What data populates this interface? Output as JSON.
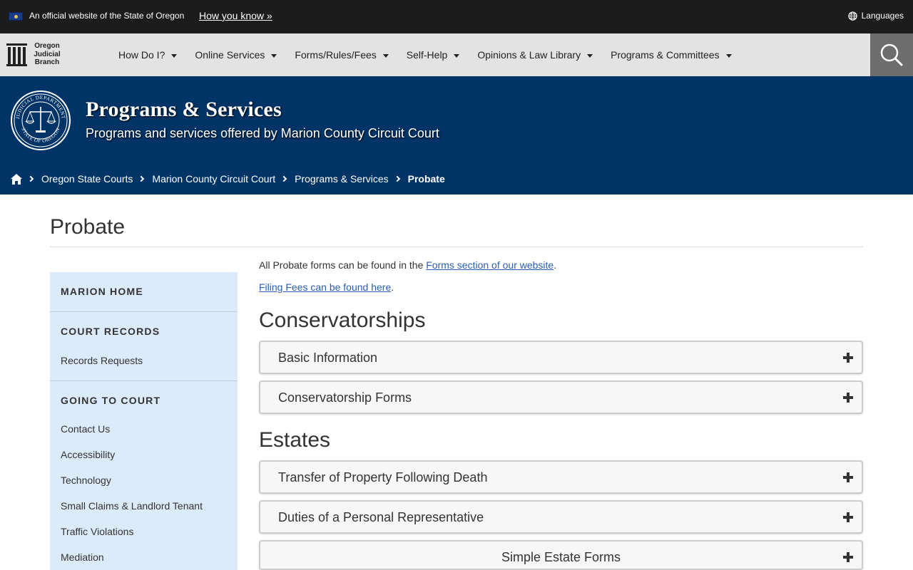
{
  "banner": {
    "official_text": "An official website of the State of Oregon",
    "how_you_know": "How you know »",
    "languages": "Languages"
  },
  "nav": {
    "logo_lines": [
      "Oregon",
      "Judicial",
      "Branch"
    ],
    "items": [
      {
        "label": "How Do I?"
      },
      {
        "label": "Online Services"
      },
      {
        "label": "Forms/Rules/Fees"
      },
      {
        "label": "Self-Help"
      },
      {
        "label": "Opinions & Law Library"
      },
      {
        "label": "Programs & Committees"
      }
    ]
  },
  "hero": {
    "title": "Programs & Services",
    "subtitle": "Programs and services offered by Marion County Circuit Court",
    "seal_text": "JUDICIAL DEPARTMENT · STATE OF OREGON"
  },
  "breadcrumb": {
    "items": [
      "Oregon State Courts",
      "Marion County Circuit Court",
      "Programs & Services"
    ],
    "current": "Probate"
  },
  "page": {
    "title": "Probate"
  },
  "sidebar": {
    "sections": [
      {
        "heading": "MARION HOME",
        "items": []
      },
      {
        "heading": "COURT RECORDS",
        "items": [
          "Records Requests"
        ]
      },
      {
        "heading": "GOING TO COURT",
        "items": [
          "Contact Us",
          "Accessibility",
          "Technology",
          "Small Claims & Landlord Tenant",
          "Traffic Violations",
          "Mediation"
        ]
      }
    ]
  },
  "main": {
    "intro_prefix": "All Probate forms can be found in the ",
    "intro_link": "Forms section of our website",
    "intro_suffix": ".",
    "fees_link": "Filing Fees can be found here",
    "fees_suffix": ".",
    "sections": [
      {
        "heading": "Conservatorships",
        "accordions": [
          "Basic Information",
          "Conservatorship Forms"
        ]
      },
      {
        "heading": "Estates",
        "accordions": [
          "Transfer of Property Following Death",
          "Duties of a Personal Representative",
          "Simple Estate Forms"
        ]
      }
    ]
  },
  "colors": {
    "hero_bg": "#003366",
    "topbar_bg": "#1c1c1c",
    "nav_bg": "#e3e3e3",
    "sidebar_bg": "#dcebfa",
    "link": "#2a5db0"
  }
}
